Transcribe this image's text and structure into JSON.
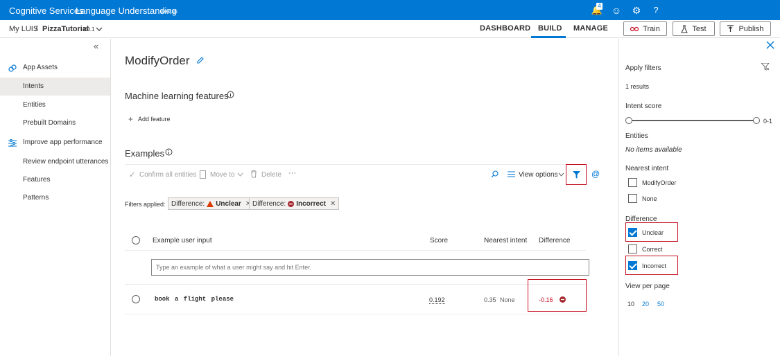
{
  "topbar": {
    "brand": "Cognitive Services",
    "app": "Language Understanding",
    "region": "westus",
    "notif_count": "4",
    "help": "?"
  },
  "subbar": {
    "crumb_root": "My LUIS",
    "sep": "/",
    "app_name": "PizzaTutorial",
    "version": "V0.1",
    "tabs": [
      "DASHBOARD",
      "BUILD",
      "MANAGE"
    ],
    "active_tab": "BUILD",
    "train": "Train",
    "test": "Test",
    "publish": "Publish"
  },
  "leftnav": {
    "collapse": "«",
    "items": [
      "App Assets",
      "Intents",
      "Entities",
      "Prebuilt Domains",
      "Improve app performance",
      "Review endpoint utterances",
      "Features",
      "Patterns"
    ]
  },
  "main": {
    "title": "ModifyOrder",
    "ml_features": "Machine learning features",
    "add_feature": "Add feature",
    "examples": "Examples",
    "toolbar": {
      "confirm": "Confirm all entities",
      "move": "Move to",
      "delete": "Delete",
      "more": "···",
      "view_options": "View options"
    },
    "filters_label": "Filters applied:",
    "chips": [
      {
        "prefix": "Difference:",
        "value": "Unclear"
      },
      {
        "prefix": "Difference:",
        "value": "Incorrect"
      }
    ],
    "table": {
      "headers": [
        "Example user input",
        "Score",
        "Nearest intent",
        "Difference"
      ],
      "placeholder": "Type an example of what a user might say and hit Enter.",
      "rows": [
        {
          "utterance": "book a flight please",
          "score": "0.192",
          "nearest_score": "0.35",
          "nearest_name": "None",
          "difference": "-0.16"
        }
      ]
    }
  },
  "rightpanel": {
    "apply_filters": "Apply filters",
    "results": "1 results",
    "intent_score": "Intent score",
    "score_range": "0-1",
    "entities": "Entities",
    "no_items": "No items available",
    "nearest_intent": "Nearest intent",
    "nearest_options": [
      {
        "label": "ModifyOrder",
        "checked": false
      },
      {
        "label": "None",
        "checked": false
      }
    ],
    "difference": "Difference",
    "difference_options": [
      {
        "label": "Unclear",
        "checked": true
      },
      {
        "label": "Correct",
        "checked": false
      },
      {
        "label": "Incorrect",
        "checked": true
      }
    ],
    "view_per_page": "View per page",
    "page_sizes": [
      "10",
      "20",
      "50"
    ]
  },
  "colors": {
    "accent": "#0078d4",
    "error": "#c50f1f",
    "warning": "#d83b01"
  }
}
